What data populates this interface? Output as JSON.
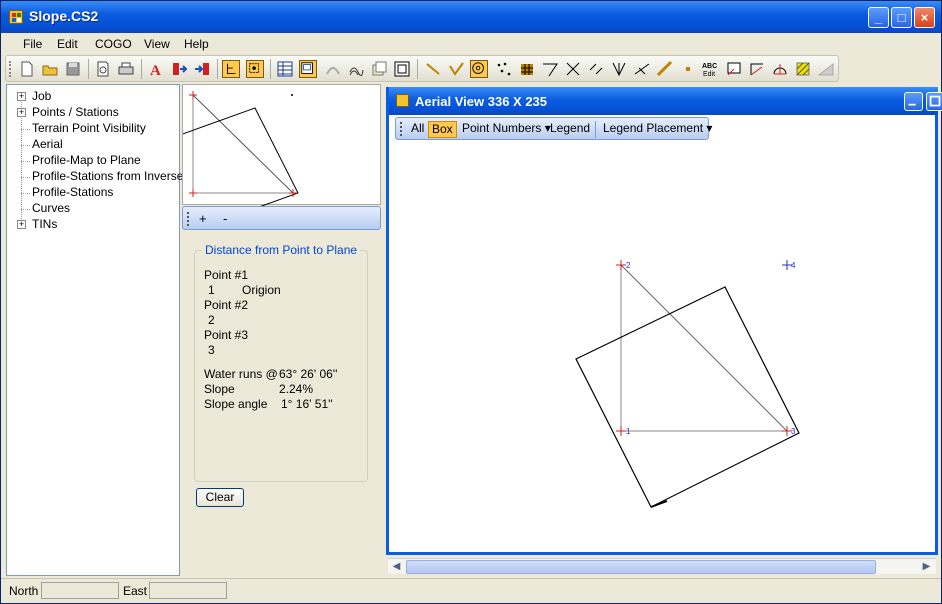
{
  "window": {
    "title": "Slope.CS2",
    "controls": {
      "minimize": "_",
      "maximize": "□",
      "close": "×"
    }
  },
  "menu": [
    "File",
    "Edit",
    "COGO",
    "View",
    "Help"
  ],
  "tree": [
    {
      "label": "Job",
      "expandable": true
    },
    {
      "label": "Points / Stations",
      "expandable": true
    },
    {
      "label": "Terrain Point Visibility",
      "expandable": false
    },
    {
      "label": "Aerial",
      "expandable": false
    },
    {
      "label": "Profile-Map to Plane",
      "expandable": false
    },
    {
      "label": "Profile-Stations from Inverse",
      "expandable": false
    },
    {
      "label": "Profile-Stations",
      "expandable": false
    },
    {
      "label": "Curves",
      "expandable": false
    },
    {
      "label": "TINs",
      "expandable": true
    }
  ],
  "mini_toolbar": {
    "zoom_in": "+",
    "zoom_out": "-"
  },
  "info": {
    "group_title": "Distance from Point to Plane",
    "point1_label": "Point #1",
    "point1_value": "1",
    "point1_desc": "Origion",
    "point2_label": "Point #2",
    "point2_value": "2",
    "point3_label": "Point #3",
    "point3_value": "3",
    "water_label": "Water runs @",
    "water_value": "63° 26' 06''",
    "slope_label": "Slope",
    "slope_value": "2.24%",
    "slope_angle_label": "Slope angle",
    "slope_angle_value": "1° 16' 51''",
    "clear_button": "Clear"
  },
  "aerial": {
    "title": "Aerial View   336  X  235",
    "toolbar": {
      "all": "All",
      "box": "Box",
      "point_numbers": "Point Numbers ▾",
      "legend": "Legend",
      "legend_placement": "Legend Placement ▾"
    },
    "points": [
      {
        "id": "1",
        "color": "#d02020"
      },
      {
        "id": "2",
        "color": "#d02020"
      },
      {
        "id": "3",
        "color": "#d02020"
      },
      {
        "id": "4",
        "color": "#2030d0"
      }
    ]
  },
  "status": {
    "north_label": "North",
    "east_label": "East"
  },
  "colors": {
    "title_blue": "#0a5ce0",
    "active_tool": "#ffc850",
    "point_red": "#d02020",
    "point_blue": "#2030d0"
  }
}
